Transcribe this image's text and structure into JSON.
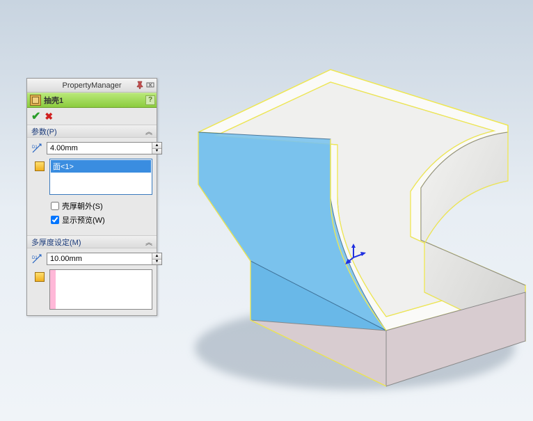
{
  "property_manager": {
    "title": "PropertyManager",
    "feature_name": "抽壳1",
    "help": "?"
  },
  "sections": {
    "params": {
      "title": "参数(P)",
      "dim_value": "4.00mm",
      "face_selected": "面<1>",
      "checkbox_outward": "壳厚朝外(S)",
      "checkbox_outward_checked": false,
      "checkbox_preview": "显示预览(W)",
      "checkbox_preview_checked": true
    },
    "multi": {
      "title": "多厚度设定(M)",
      "dim_value": "10.00mm"
    }
  },
  "colors": {
    "selected_face": "#69b8e8",
    "outline": "#f0e850"
  }
}
